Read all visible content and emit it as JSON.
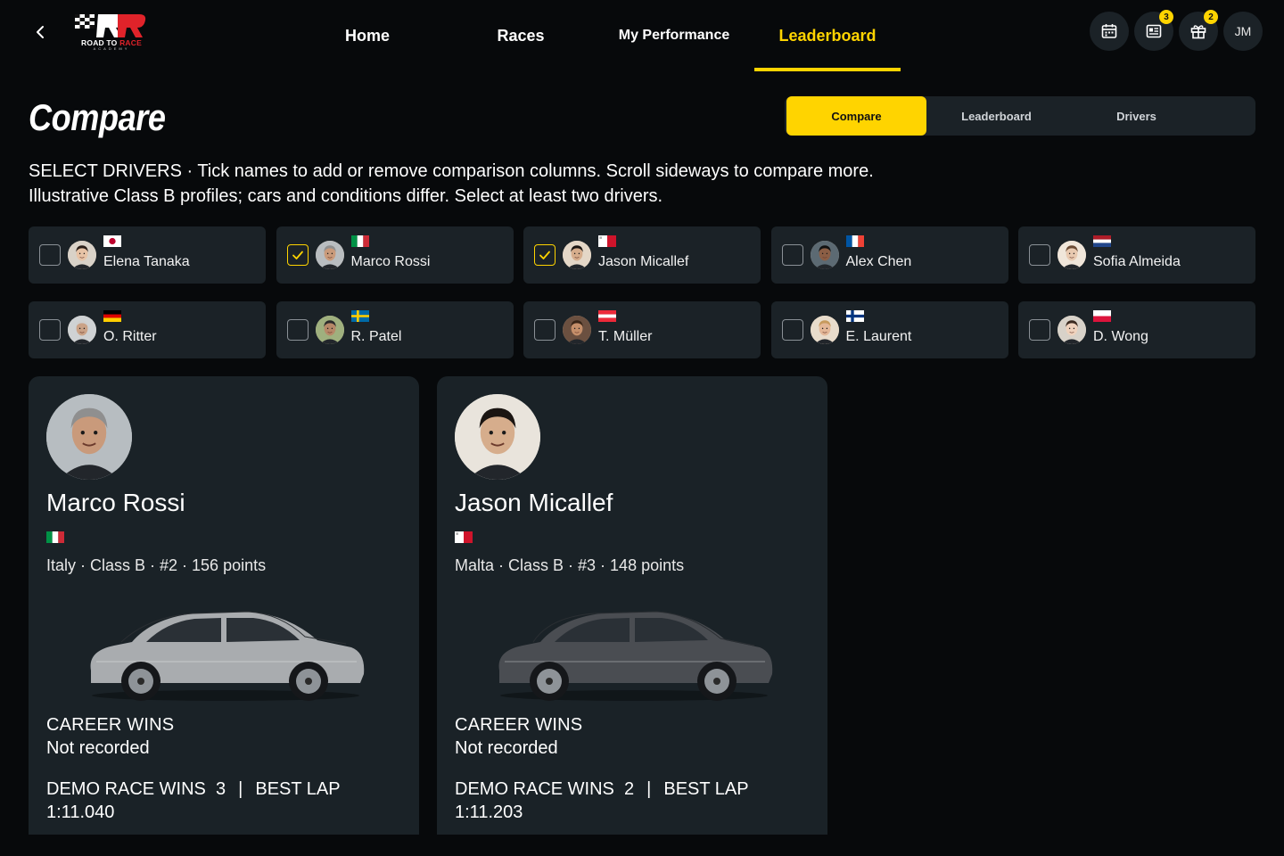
{
  "brand": {
    "logo_text_white": "ROAD TO",
    "logo_text_red": "RACE",
    "logo_sub": "ACADEMY"
  },
  "nav": {
    "tabs": [
      {
        "label": "Home"
      },
      {
        "label": "Races"
      },
      {
        "label": "My Performance"
      },
      {
        "label": "Leaderboard"
      }
    ],
    "active_tab": "Leaderboard",
    "icons": [
      {
        "name": "calendar-icon",
        "badge": null
      },
      {
        "name": "news-icon",
        "badge": "3"
      },
      {
        "name": "gift-icon",
        "badge": "2"
      }
    ],
    "user_initials": "JM"
  },
  "header": {
    "title": "Compare",
    "segments": [
      "Compare",
      "Leaderboard",
      "Drivers"
    ],
    "active_segment": "Compare",
    "description_line1": "SELECT DRIVERS · Tick names to add or remove comparison columns. Scroll sideways to compare more.",
    "description_line2": "Illustrative Class B profiles; cars and conditions differ. Select at least two drivers."
  },
  "drivers": [
    {
      "name": "Elena Tanaka",
      "flag": "japan",
      "checked": false
    },
    {
      "name": "Marco Rossi",
      "flag": "italy",
      "checked": true
    },
    {
      "name": "Jason Micallef",
      "flag": "malta",
      "checked": true
    },
    {
      "name": "Alex Chen",
      "flag": "france",
      "checked": false
    },
    {
      "name": "Sofia Almeida",
      "flag": "netherlands",
      "checked": false
    },
    {
      "name": "O. Ritter",
      "flag": "germany",
      "checked": false
    },
    {
      "name": "R. Patel",
      "flag": "sweden",
      "checked": false
    },
    {
      "name": "T. Müller",
      "flag": "austria",
      "checked": false
    },
    {
      "name": "E. Laurent",
      "flag": "finland",
      "checked": false
    },
    {
      "name": "D. Wong",
      "flag": "poland",
      "checked": false
    }
  ],
  "compare": [
    {
      "name": "Marco Rossi",
      "flag": "italy",
      "meta": "Italy · Class B · #2 · 156 points",
      "car_color": "#a9acaf",
      "career_label": "CAREER WINS",
      "career_value": "Not recorded",
      "demo_label": "DEMO RACE WINS",
      "demo_value": "3",
      "lap_label": "BEST LAP",
      "lap_value": "1:11.040"
    },
    {
      "name": "Jason Micallef",
      "flag": "malta",
      "meta": "Malta · Class B · #3 · 148 points",
      "car_color": "#4a4d52",
      "career_label": "CAREER WINS",
      "career_value": "Not recorded",
      "demo_label": "DEMO RACE WINS",
      "demo_value": "2",
      "lap_label": "BEST LAP",
      "lap_value": "1:11.203"
    }
  ]
}
